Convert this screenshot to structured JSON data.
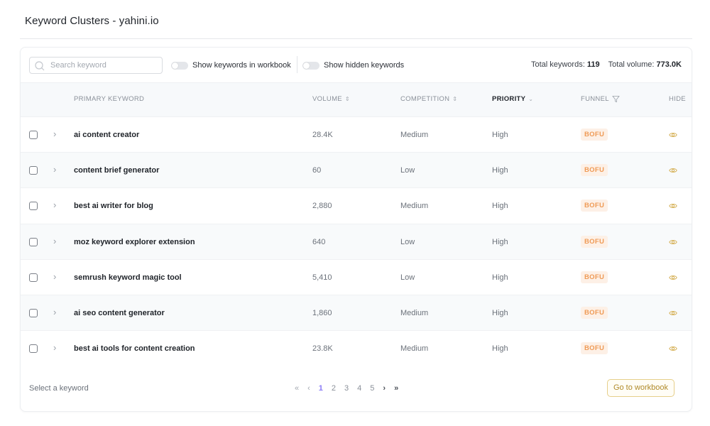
{
  "page": {
    "title": "Keyword Clusters - yahini.io"
  },
  "toolbar": {
    "search_placeholder": "Search keyword",
    "search_value": "",
    "toggle_workbook_label": "Show keywords in workbook",
    "toggle_workbook_on": false,
    "toggle_hidden_label": "Show hidden keywords",
    "toggle_hidden_on": false,
    "total_keywords_label": "Total keywords:",
    "total_keywords_value": "119",
    "total_volume_label": "Total volume:",
    "total_volume_value": "773.0K"
  },
  "table": {
    "columns": {
      "keyword": "PRIMARY KEYWORD",
      "volume": "VOLUME",
      "competition": "COMPETITION",
      "priority": "PRIORITY",
      "funnel": "FUNNEL",
      "hide": "HIDE"
    },
    "sort_icon": "sort-icon",
    "active_sort_column": "priority",
    "rows": [
      {
        "keyword": "ai content creator",
        "volume": "28.4K",
        "competition": "Medium",
        "priority": "High",
        "funnel": "BOFU"
      },
      {
        "keyword": "content brief generator",
        "volume": "60",
        "competition": "Low",
        "priority": "High",
        "funnel": "BOFU"
      },
      {
        "keyword": "best ai writer for blog",
        "volume": "2,880",
        "competition": "Medium",
        "priority": "High",
        "funnel": "BOFU"
      },
      {
        "keyword": "moz keyword explorer extension",
        "volume": "640",
        "competition": "Low",
        "priority": "High",
        "funnel": "BOFU"
      },
      {
        "keyword": "semrush keyword magic tool",
        "volume": "5,410",
        "competition": "Low",
        "priority": "High",
        "funnel": "BOFU"
      },
      {
        "keyword": "ai seo content generator",
        "volume": "1,860",
        "competition": "Medium",
        "priority": "High",
        "funnel": "BOFU"
      },
      {
        "keyword": "best ai tools for content creation",
        "volume": "23.8K",
        "competition": "Medium",
        "priority": "High",
        "funnel": "BOFU"
      }
    ]
  },
  "footer": {
    "status_text": "Select a keyword",
    "pagination": {
      "first": "«",
      "prev": "‹",
      "pages": [
        "1",
        "2",
        "3",
        "4",
        "5"
      ],
      "current": "1",
      "next": "›",
      "last": "»"
    },
    "goto_workbook_label": "Go to workbook"
  },
  "colors": {
    "accent_current_page": "#8b7cf6",
    "badge_bofu_bg": "#fdf0e6",
    "badge_bofu_text": "#ef9a55",
    "eye_icon": "#d4ad4f",
    "goto_button_border": "#e6cf8a"
  }
}
